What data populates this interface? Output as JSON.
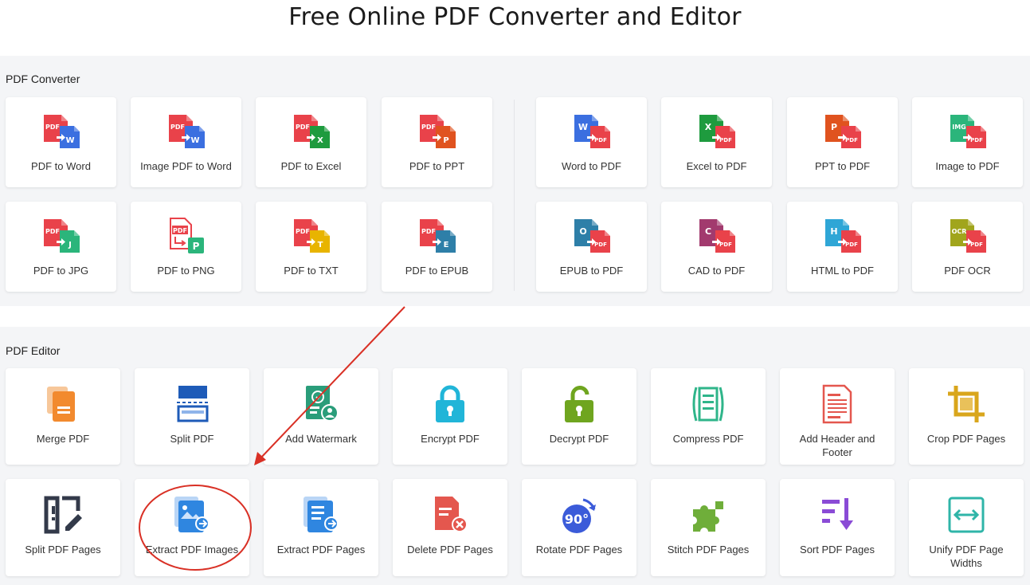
{
  "page": {
    "title": "Free Online PDF Converter and Editor"
  },
  "converter": {
    "label": "PDF Converter",
    "cards": [
      {
        "label": "PDF to Word",
        "icon": "pdf-to-word-icon",
        "from": "PDF",
        "to": "W",
        "color": "#3b6fe0"
      },
      {
        "label": "Image PDF to Word",
        "icon": "image-pdf-to-word-icon",
        "from": "PDF",
        "to": "W",
        "color": "#3b6fe0"
      },
      {
        "label": "PDF to Excel",
        "icon": "pdf-to-excel-icon",
        "from": "PDF",
        "to": "X",
        "color": "#1e9b3e"
      },
      {
        "label": "PDF to PPT",
        "icon": "pdf-to-ppt-icon",
        "from": "PDF",
        "to": "P",
        "color": "#e0531f"
      },
      {
        "label": "Word to PDF",
        "icon": "word-to-pdf-icon",
        "from": "W",
        "to": "PDF",
        "color": "#3b6fe0"
      },
      {
        "label": "Excel to PDF",
        "icon": "excel-to-pdf-icon",
        "from": "X",
        "to": "PDF",
        "color": "#1e9b3e"
      },
      {
        "label": "PPT to PDF",
        "icon": "ppt-to-pdf-icon",
        "from": "P",
        "to": "PDF",
        "color": "#e0531f"
      },
      {
        "label": "Image to PDF",
        "icon": "image-to-pdf-icon",
        "from": "IMG",
        "to": "PDF",
        "color": "#2bb57b"
      },
      {
        "label": "PDF to JPG",
        "icon": "pdf-to-jpg-icon",
        "from": "PDF",
        "to": "J",
        "color": "#2bb57b"
      },
      {
        "label": "PDF to PNG",
        "icon": "pdf-to-png-icon",
        "from": "PDF",
        "to": "P",
        "color": "#2bb57b"
      },
      {
        "label": "PDF to TXT",
        "icon": "pdf-to-txt-icon",
        "from": "PDF",
        "to": "T",
        "color": "#e8b400"
      },
      {
        "label": "PDF to EPUB",
        "icon": "pdf-to-epub-icon",
        "from": "PDF",
        "to": "E",
        "color": "#2e7fa8"
      },
      {
        "label": "EPUB to PDF",
        "icon": "epub-to-pdf-icon",
        "from": "O",
        "to": "PDF",
        "color": "#2e7fa8"
      },
      {
        "label": "CAD to PDF",
        "icon": "cad-to-pdf-icon",
        "from": "C",
        "to": "PDF",
        "color": "#a23a6e"
      },
      {
        "label": "HTML to PDF",
        "icon": "html-to-pdf-icon",
        "from": "H",
        "to": "PDF",
        "color": "#2fa6d6"
      },
      {
        "label": "PDF OCR",
        "icon": "pdf-ocr-icon",
        "from": "OCR",
        "to": "PDF",
        "color": "#a1a51c"
      }
    ]
  },
  "editor": {
    "label": "PDF Editor",
    "cards": [
      {
        "label": "Merge PDF",
        "icon": "merge-pdf-icon",
        "color": "#f28a2e"
      },
      {
        "label": "Split PDF",
        "icon": "split-pdf-icon",
        "color": "#1e5bb8"
      },
      {
        "label": "Add Watermark",
        "icon": "watermark-icon",
        "color": "#2a9d7a"
      },
      {
        "label": "Encrypt PDF",
        "icon": "lock-icon",
        "color": "#21b5d8"
      },
      {
        "label": "Decrypt PDF",
        "icon": "unlock-icon",
        "color": "#6fa51f"
      },
      {
        "label": "Compress PDF",
        "icon": "compress-icon",
        "color": "#2fb58a"
      },
      {
        "label": "Add Header and Footer",
        "icon": "header-footer-icon",
        "color": "#e4574e"
      },
      {
        "label": "Crop PDF Pages",
        "icon": "crop-icon",
        "color": "#d9a61c"
      },
      {
        "label": "Split PDF Pages",
        "icon": "split-pages-icon",
        "color": "#333a4a"
      },
      {
        "label": "Extract PDF Images",
        "icon": "extract-images-icon",
        "color": "#2f86e0"
      },
      {
        "label": "Extract PDF Pages",
        "icon": "extract-pages-icon",
        "color": "#2f86e0"
      },
      {
        "label": "Delete PDF Pages",
        "icon": "delete-pages-icon",
        "color": "#e4574e"
      },
      {
        "label": "Rotate PDF Pages",
        "icon": "rotate-icon",
        "color": "#3b5bd9",
        "badge": "90°"
      },
      {
        "label": "Stitch PDF Pages",
        "icon": "puzzle-icon",
        "color": "#6fae3a"
      },
      {
        "label": "Sort PDF Pages",
        "icon": "sort-icon",
        "color": "#8a4bd6"
      },
      {
        "label": "Unify PDF Page Widths",
        "icon": "unify-width-icon",
        "color": "#2fb5a8"
      }
    ]
  },
  "annotation": {
    "arrow_color": "#d93025",
    "circle_color": "#d93025"
  }
}
